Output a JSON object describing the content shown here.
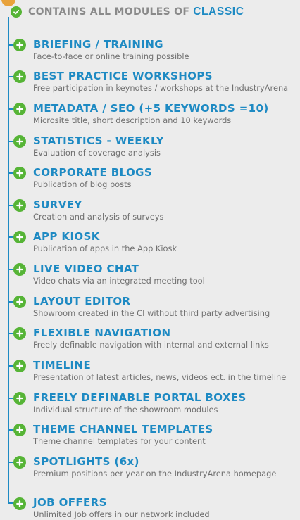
{
  "header": {
    "text": "CONTAINS ALL MODULES OF",
    "brand": "CLASSIC"
  },
  "items": [
    {
      "title": "BRIEFING / TRAINING",
      "desc": "Face-to-face or online training possible"
    },
    {
      "title": "BEST PRACTICE WORKSHOPS",
      "desc": "Free participation in keynotes / workshops at the IndustryArena"
    },
    {
      "title": "METADATA / SEO (+5 KEYWORDS =10)",
      "desc": "Microsite title, short description and 10 keywords"
    },
    {
      "title": "STATISTICS - WEEKLY",
      "desc": "Evaluation of coverage analysis"
    },
    {
      "title": "CORPORATE BLOGS",
      "desc": "Publication of blog posts"
    },
    {
      "title": "SURVEY",
      "desc": "Creation and analysis of surveys"
    },
    {
      "title": "APP KIOSK",
      "desc": "Publication of apps in the App Kiosk"
    },
    {
      "title": "LIVE VIDEO CHAT",
      "desc": "Video chats via an integrated meeting tool"
    },
    {
      "title": "LAYOUT EDITOR",
      "desc": "Showroom created in the CI without third party advertising"
    },
    {
      "title": "FLEXIBLE NAVIGATION",
      "desc": "Freely definable navigation with internal and external links"
    },
    {
      "title": "TIMELINE",
      "desc": "Presentation of latest articles, news, videos ect. in the timeline"
    },
    {
      "title": "FREELY DEFINABLE PORTAL BOXES",
      "desc": "Individual structure of the showroom modules"
    },
    {
      "title": "THEME CHANNEL TEMPLATES",
      "desc": "Theme channel templates for your content"
    },
    {
      "title": "SPOTLIGHTS (6x)",
      "desc": "Premium positions per year on the IndustryArena homepage"
    },
    {
      "title": "JOB OFFERS",
      "desc": "Unlimited Job offers in our network included"
    }
  ],
  "colors": {
    "accent": "#1e8ac3",
    "icon_green": "#56b436",
    "top_badge": "#e8a23b",
    "header_text": "#8a8a8a",
    "desc_text": "#6f6f6f",
    "background": "#ececec"
  },
  "icons": {
    "header": "check-circle-icon",
    "item": "plus-circle-icon",
    "top": "orange-circle-icon"
  }
}
